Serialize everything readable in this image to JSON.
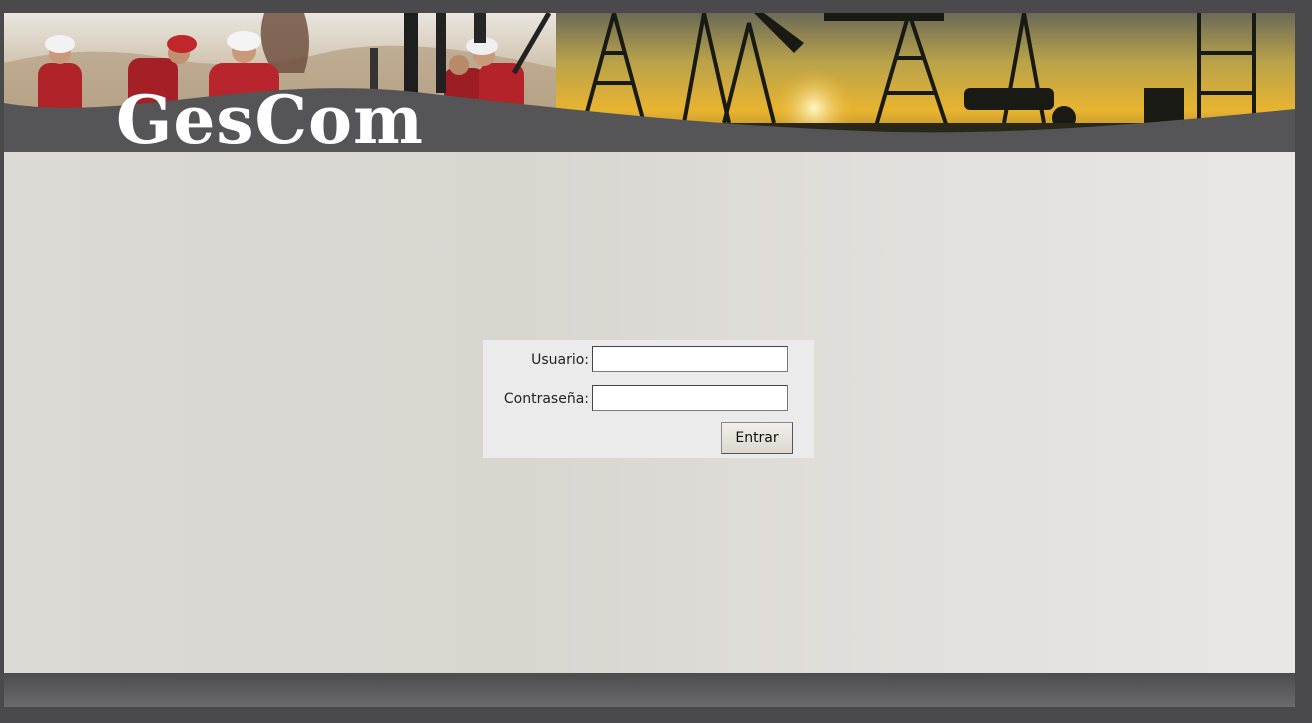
{
  "app": {
    "logo_text": "GesCom"
  },
  "login": {
    "username_label": "Usuario:",
    "username_value": "",
    "password_label": "Contraseña:",
    "password_value": "",
    "submit_label": "Entrar"
  },
  "colors": {
    "frame": "#4a4a4c",
    "content_bg": "#dcdad5",
    "login_box_bg": "#ebebeb",
    "sunset": "#e8b430"
  }
}
